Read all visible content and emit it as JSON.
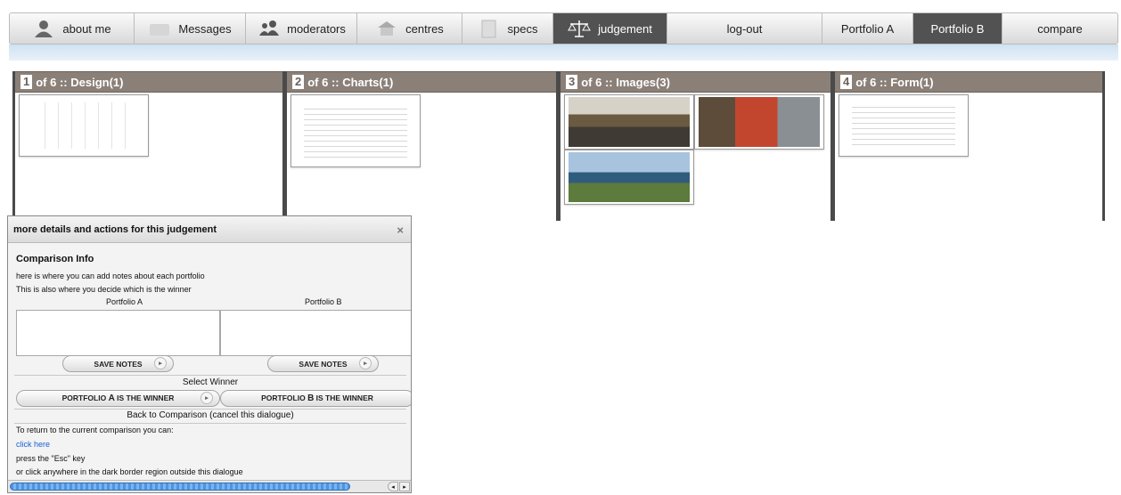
{
  "nav": {
    "items": [
      {
        "label": "about me",
        "icon": "user-icon"
      },
      {
        "label": "Messages",
        "icon": "messages-icon"
      },
      {
        "label": "moderators",
        "icon": "moderators-icon"
      },
      {
        "label": "centres",
        "icon": "centres-icon"
      },
      {
        "label": "specs",
        "icon": "specs-icon"
      },
      {
        "label": "judgement",
        "icon": "scales-icon",
        "active": true
      },
      {
        "label": "log-out"
      },
      {
        "label": "Portfolio A"
      },
      {
        "label": "Portfolio B",
        "active": true
      },
      {
        "label": "compare"
      }
    ]
  },
  "panels": [
    {
      "num": "1",
      "title": "of 6 :: Design(1)"
    },
    {
      "num": "2",
      "title": "of 6 :: Charts(1)"
    },
    {
      "num": "3",
      "title": "of 6 :: Images(3)"
    },
    {
      "num": "4",
      "title": "of 6 :: Form(1)"
    }
  ],
  "dialog": {
    "title": "more details and actions for this judgement",
    "close": "×",
    "section_heading": "Comparison Info",
    "line1": "here is where you can add notes about each portfolio",
    "line2": "This is also where you decide which is the winner",
    "portfolio_a": "Portfolio A",
    "portfolio_b": "Portfolio B",
    "save_notes": "SAVE NOTES",
    "select_winner": "Select Winner",
    "winner_a_pre": "PORTFOLIO ",
    "winner_a_letter": "A",
    "winner_a_post": " IS THE WINNER",
    "winner_b_pre": "PORTFOLIO ",
    "winner_b_letter": "B",
    "winner_b_post": " IS THE WINNER",
    "back": "Back to Comparison (cancel this dialogue)",
    "return_text": "To return to the current comparison you can:",
    "click_here": "click here",
    "esc_text": "press the \"Esc\" key",
    "outside_text": "or click anywhere in the dark border region outside this dialogue"
  },
  "colors": {
    "active_tab": "#525252",
    "panel_header": "#8b8078",
    "link": "#1a5fd6",
    "scroll_thumb": "#4e94e0"
  }
}
